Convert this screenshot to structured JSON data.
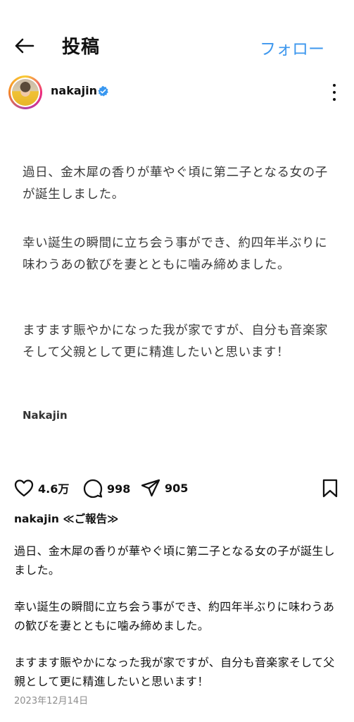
{
  "header": {
    "title": "投稿",
    "follow_label": "フォロー"
  },
  "account": {
    "username": "nakajin"
  },
  "post_image": {
    "paragraph1": "過日、金木犀の香りが華やぐ頃に第二子となる女の子が誕生しました。",
    "paragraph2": "幸い誕生の瞬間に立ち会う事ができ、約四年半ぶりに味わうあの歓びを妻とともに噛み締めました。",
    "paragraph3": "ますます賑やかになった我が家ですが、自分も音楽家そして父親として更に精進したいと思います！",
    "signature": "Nakajin"
  },
  "actions": {
    "likes": "4.6万",
    "comments": "998",
    "shares": "905"
  },
  "caption": {
    "username": "nakajin",
    "title": "≪ご報告≫",
    "paragraph1": "過日、金木犀の香りが華やぐ頃に第二子となる女の子が誕生しました。",
    "paragraph2": "幸い誕生の瞬間に立ち会う事ができ、約四年半ぶりに味わうあの歓びを妻とともに噛み締めました。",
    "paragraph3": "ますます賑やかになった我が家ですが、自分も音楽家そして父親として更に精進したいと思います！",
    "date": "2023年12月14日"
  },
  "colors": {
    "accent": "#3d97ee",
    "verified": "#3897f0",
    "muted": "#8e8e8e"
  },
  "icons": [
    "back-arrow-icon",
    "verified-badge-icon",
    "more-options-icon",
    "heart-icon",
    "comment-icon",
    "share-icon",
    "bookmark-icon"
  ]
}
